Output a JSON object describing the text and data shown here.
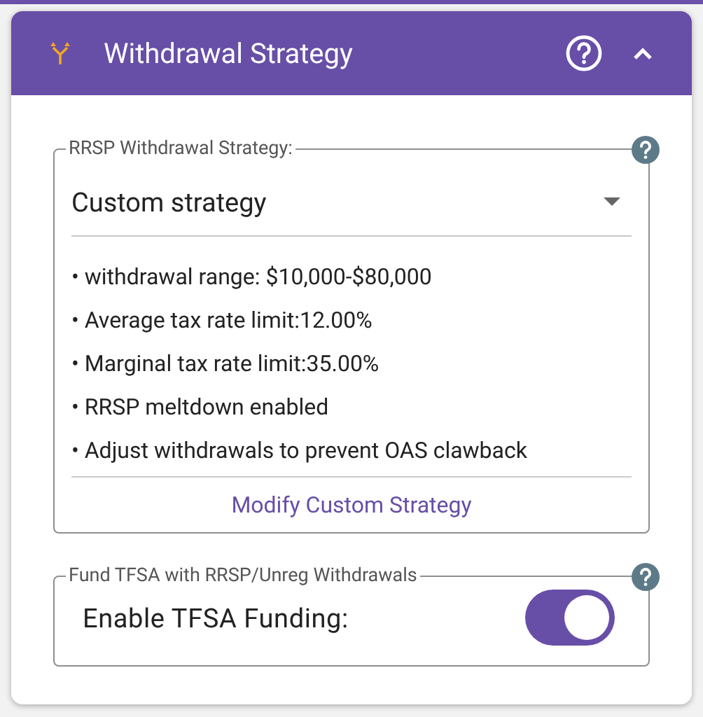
{
  "header": {
    "title": "Withdrawal Strategy",
    "expanded": true
  },
  "rrsp": {
    "legend": "RRSP Withdrawal Strategy:",
    "select_value": "Custom strategy",
    "bullets": [
      "• withdrawal range: $10,000-$80,000",
      "• Average tax rate limit:12.00%",
      "• Marginal tax rate limit:35.00%",
      "• RRSP meltdown enabled",
      "• Adjust withdrawals to prevent OAS clawback"
    ],
    "link": "Modify Custom Strategy"
  },
  "tfsa": {
    "legend": "Fund TFSA with RRSP/Unreg Withdrawals",
    "label": "Enable TFSA Funding:",
    "on": true
  }
}
